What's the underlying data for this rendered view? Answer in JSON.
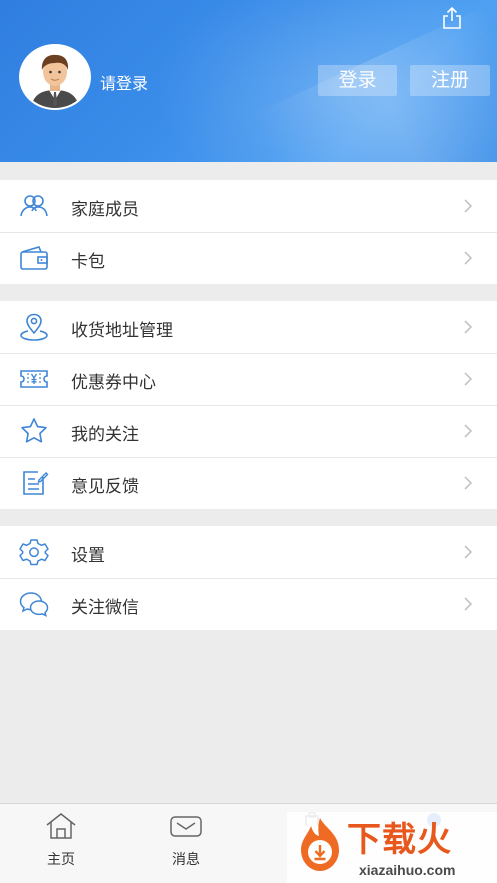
{
  "header": {
    "login_prompt": "请登录",
    "login_button": "登录",
    "register_button": "注册"
  },
  "groups": [
    {
      "items": [
        {
          "label": "家庭成员",
          "icon": "family-icon"
        },
        {
          "label": "卡包",
          "icon": "wallet-icon"
        }
      ]
    },
    {
      "items": [
        {
          "label": "收货地址管理",
          "icon": "location-icon"
        },
        {
          "label": "优惠券中心",
          "icon": "coupon-icon"
        },
        {
          "label": "我的关注",
          "icon": "star-icon"
        },
        {
          "label": "意见反馈",
          "icon": "feedback-icon"
        }
      ]
    },
    {
      "items": [
        {
          "label": "设置",
          "icon": "gear-icon"
        },
        {
          "label": "关注微信",
          "icon": "wechat-icon"
        }
      ]
    }
  ],
  "tabbar": {
    "tabs": [
      {
        "label": "主页",
        "icon": "home-icon"
      },
      {
        "label": "消息",
        "icon": "message-icon"
      }
    ]
  },
  "watermark": {
    "brand": "下载火",
    "url": "xiazaihuo.com"
  },
  "colors": {
    "header_blue": "#3b8eea",
    "icon_blue": "#3f86d6",
    "watermark_orange": "#e8571b"
  }
}
